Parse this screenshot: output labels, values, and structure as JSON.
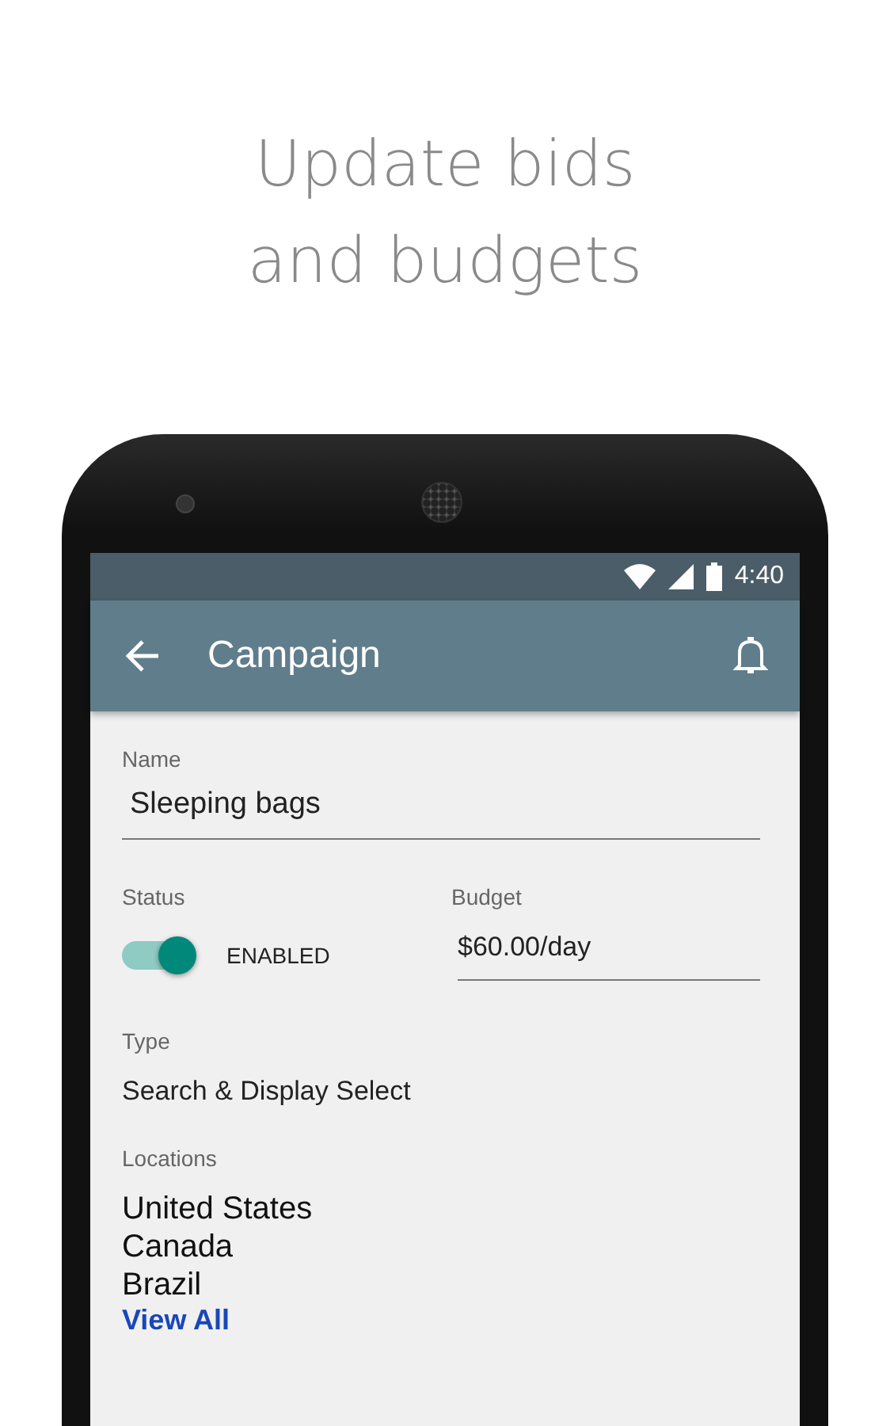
{
  "headline": [
    "Update bids",
    "and budgets"
  ],
  "status_bar": {
    "time": "4:40"
  },
  "toolbar": {
    "title": "Campaign"
  },
  "name": {
    "label": "Name",
    "value": "Sleeping bags"
  },
  "status": {
    "label": "Status",
    "on": true,
    "text": "ENABLED"
  },
  "budget": {
    "label": "Budget",
    "value": "$60.00/day"
  },
  "type": {
    "label": "Type",
    "value": "Search & Display Select"
  },
  "locations": {
    "label": "Locations",
    "items": [
      "United States",
      "Canada",
      "Brazil"
    ],
    "link": "View All"
  }
}
